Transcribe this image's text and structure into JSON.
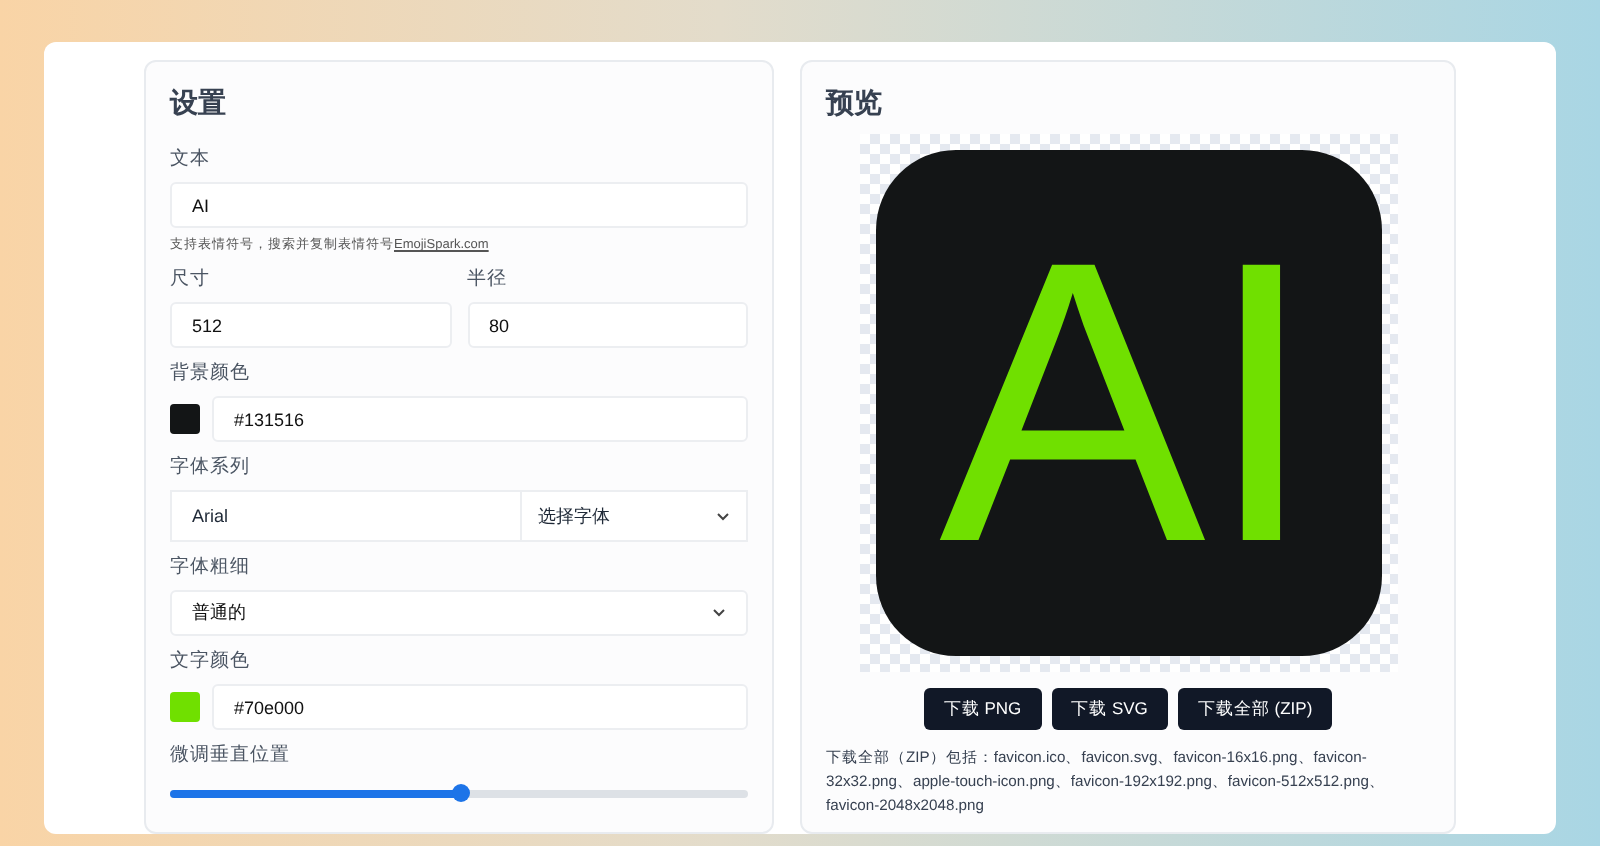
{
  "settings": {
    "title": "设置",
    "text_field": {
      "label": "文本",
      "value": "AI"
    },
    "hint": {
      "text": "支持表情符号，搜索并复制表情符号",
      "link": "EmojiSpark.com"
    },
    "size_field": {
      "label": "尺寸",
      "value": "512"
    },
    "radius_field": {
      "label": "半径",
      "value": "80"
    },
    "background_color": {
      "label": "背景颜色",
      "color": "#131516",
      "value": "#131516"
    },
    "font_family": {
      "label": "字体系列",
      "value": "Arial",
      "select": "选择字体"
    },
    "font_weight": {
      "label": "字体粗细",
      "value": "普通的"
    },
    "text_color": {
      "label": "文字颜色",
      "color": "#70e000",
      "value": "#70e000"
    },
    "vertical_offset": {
      "label": "微调垂直位置",
      "level": 0.5
    }
  },
  "preview": {
    "title": "预览",
    "text": "AI",
    "buttons": [
      "下载 PNG",
      "下载 SVG",
      "下载全部 (ZIP)"
    ],
    "note": "下载全部（ZIP）包括：favicon.ico、favicon.svg、favicon-16x16.png、favicon-32x32.png、apple-touch-icon.png、favicon-192x192.png、favicon-512x512.png、favicon-2048x2048.png"
  }
}
